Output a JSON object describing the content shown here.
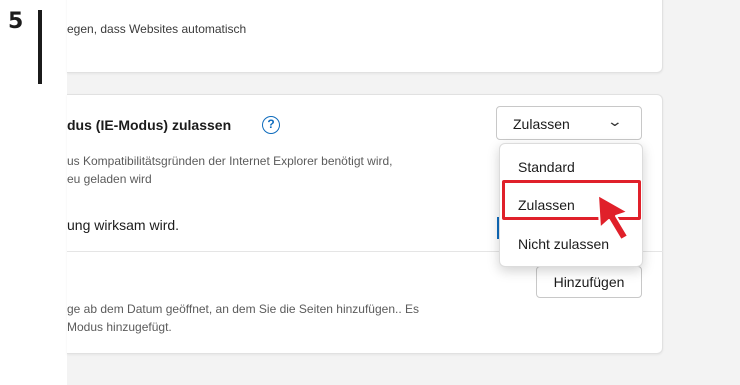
{
  "step": {
    "number": "5"
  },
  "top_card": {
    "description": "egen, dass Websites automatisch"
  },
  "ie_mode": {
    "title": "dus (IE-Modus) zulassen",
    "description_line1": "us Kompatibilitätsgründen der Internet Explorer benötigt wird,",
    "description_line2": "eu geladen wird",
    "restart_notice": "ung wirksam wird.",
    "select": {
      "value": "Zulassen"
    },
    "options": [
      "Standard",
      "Zulassen",
      "Nicht zulassen"
    ]
  },
  "ie_pages": {
    "add_button": "Hinzufügen",
    "description_line1": "ge ab dem Datum geöffnet, an dem Sie die Seiten hinzufügen.. Es",
    "description_line2": "Modus hinzugefügt."
  },
  "colors": {
    "highlight": "#e0202a",
    "accent": "#0f6cbd",
    "cursor": "#e0202a"
  }
}
